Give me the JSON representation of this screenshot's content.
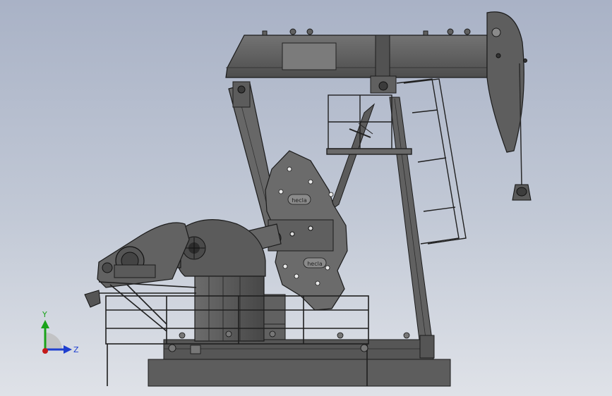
{
  "viewport": {
    "background_top": "#a9b2c6",
    "background_bottom": "#dfe2e8"
  },
  "model": {
    "subject": "pumpjack-assembly",
    "counterweight_labels": [
      "hecla",
      "hecla"
    ],
    "body_color": "#5a5a5a",
    "edge_color": "#1a1a1a",
    "face_light": "#7c7c7c",
    "face_dark": "#3e3e3e"
  },
  "triad": {
    "y_label": "Y",
    "z_label": "Z",
    "y_color": "#1aa31a",
    "z_color": "#1f3fcf",
    "x_color": "#c41a1a"
  }
}
